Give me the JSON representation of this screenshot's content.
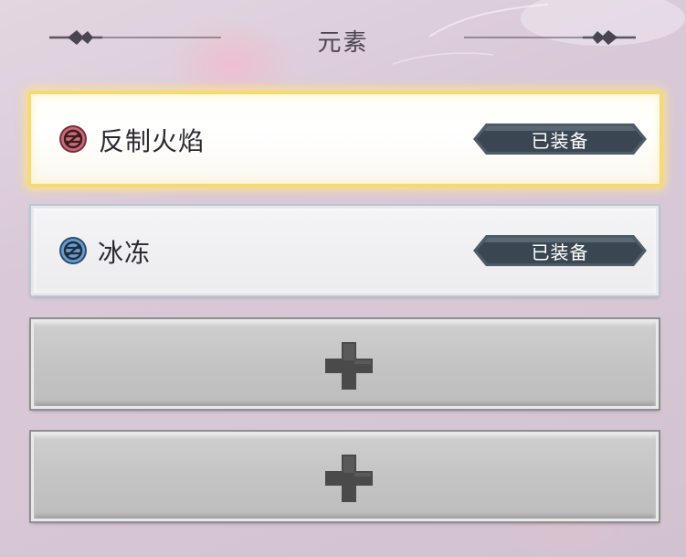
{
  "header": {
    "title": "元素"
  },
  "slots": [
    {
      "name": "反制火焰",
      "status": "已装备",
      "icon": "fire-counter-element-icon",
      "selected": true,
      "color": "#b8505e"
    },
    {
      "name": "冰冻",
      "status": "已装备",
      "icon": "ice-element-icon",
      "selected": false,
      "color": "#3d6f9c"
    },
    {
      "icon": "plus-icon"
    },
    {
      "icon": "plus-icon"
    }
  ]
}
